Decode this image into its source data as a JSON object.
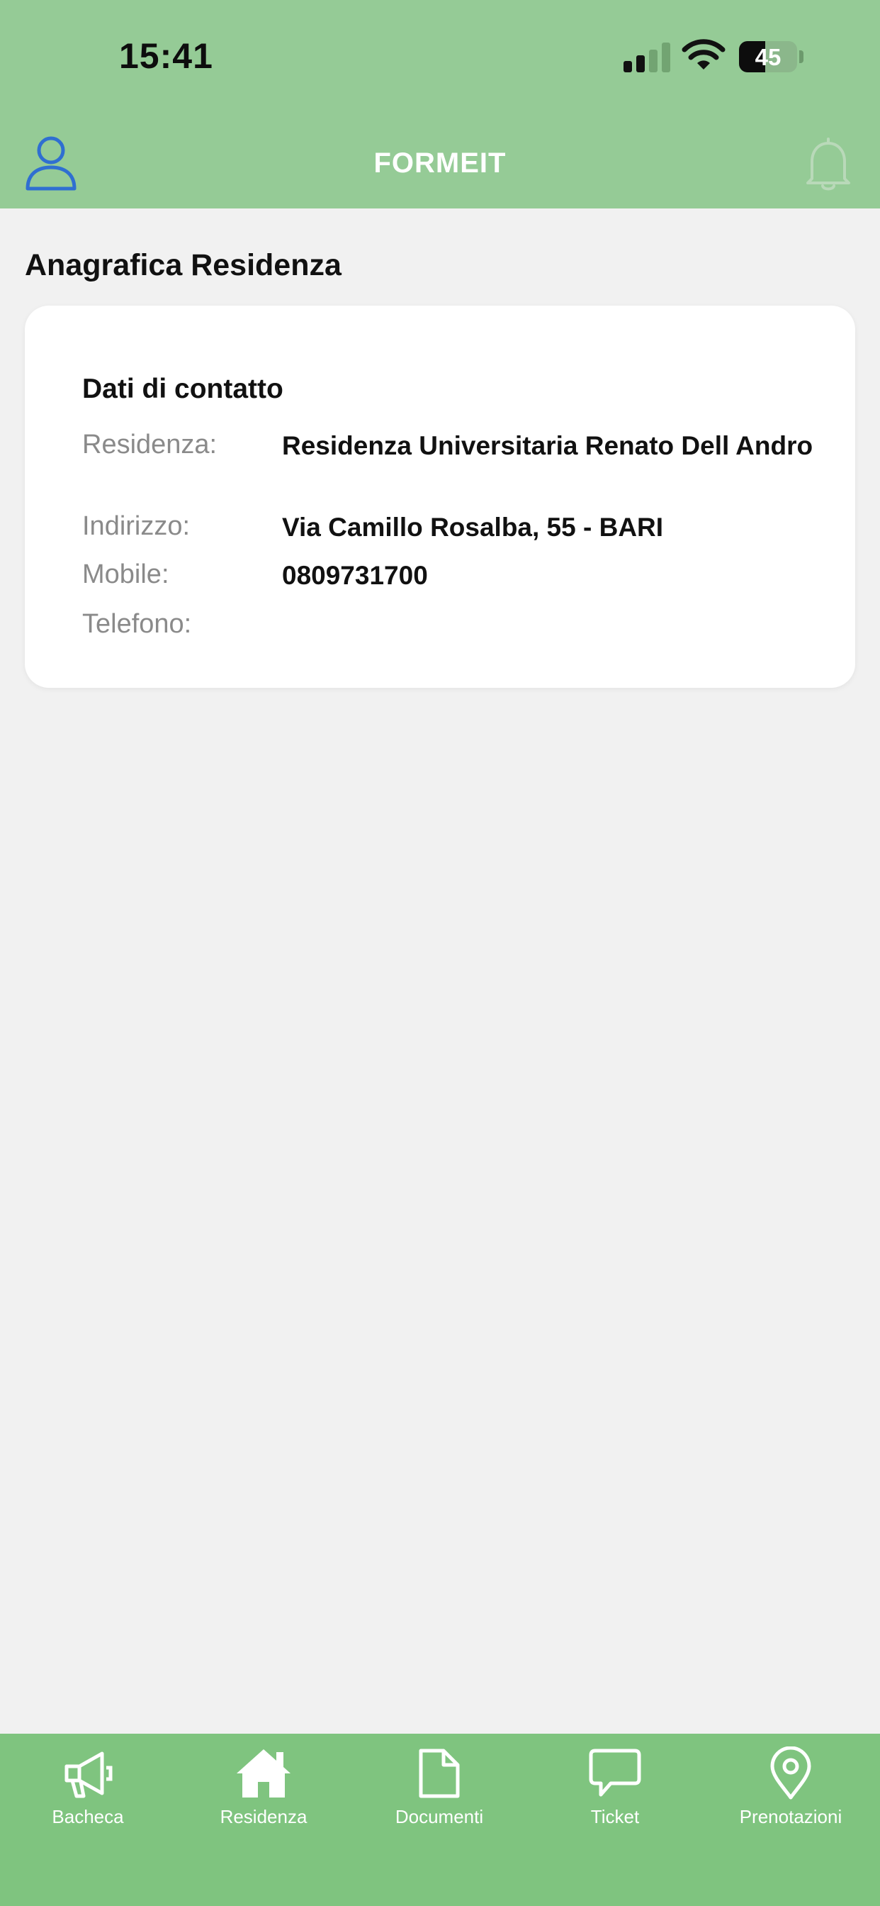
{
  "status_bar": {
    "time": "15:41",
    "battery_percent": "45",
    "battery_level": 0.45
  },
  "header": {
    "title": "FORMEIT",
    "profile_icon": "user-icon",
    "notification_icon": "bell-icon"
  },
  "page": {
    "title": "Anagrafica Residenza"
  },
  "card": {
    "title": "Dati di contatto",
    "rows": [
      {
        "label": "Residenza:",
        "value": "Residenza Universitaria Renato Dell Andro"
      },
      {
        "label": "Indirizzo:",
        "value": "Via Camillo Rosalba, 55 - BARI"
      },
      {
        "label": "Mobile:",
        "value": "0809731700"
      },
      {
        "label": "Telefono:",
        "value": ""
      }
    ]
  },
  "tabbar": {
    "items": [
      {
        "label": "Bacheca",
        "icon": "megaphone-icon"
      },
      {
        "label": "Residenza",
        "icon": "home-icon",
        "active": true
      },
      {
        "label": "Documenti",
        "icon": "document-icon"
      },
      {
        "label": "Ticket",
        "icon": "chat-bubble-icon"
      },
      {
        "label": "Prenotazioni",
        "icon": "location-pin-icon"
      }
    ]
  },
  "colors": {
    "header_bg": "#95cb96",
    "tabbar_bg": "#7fc47f",
    "page_bg": "#f1f1f1",
    "profile_icon": "#2f6fd1"
  }
}
